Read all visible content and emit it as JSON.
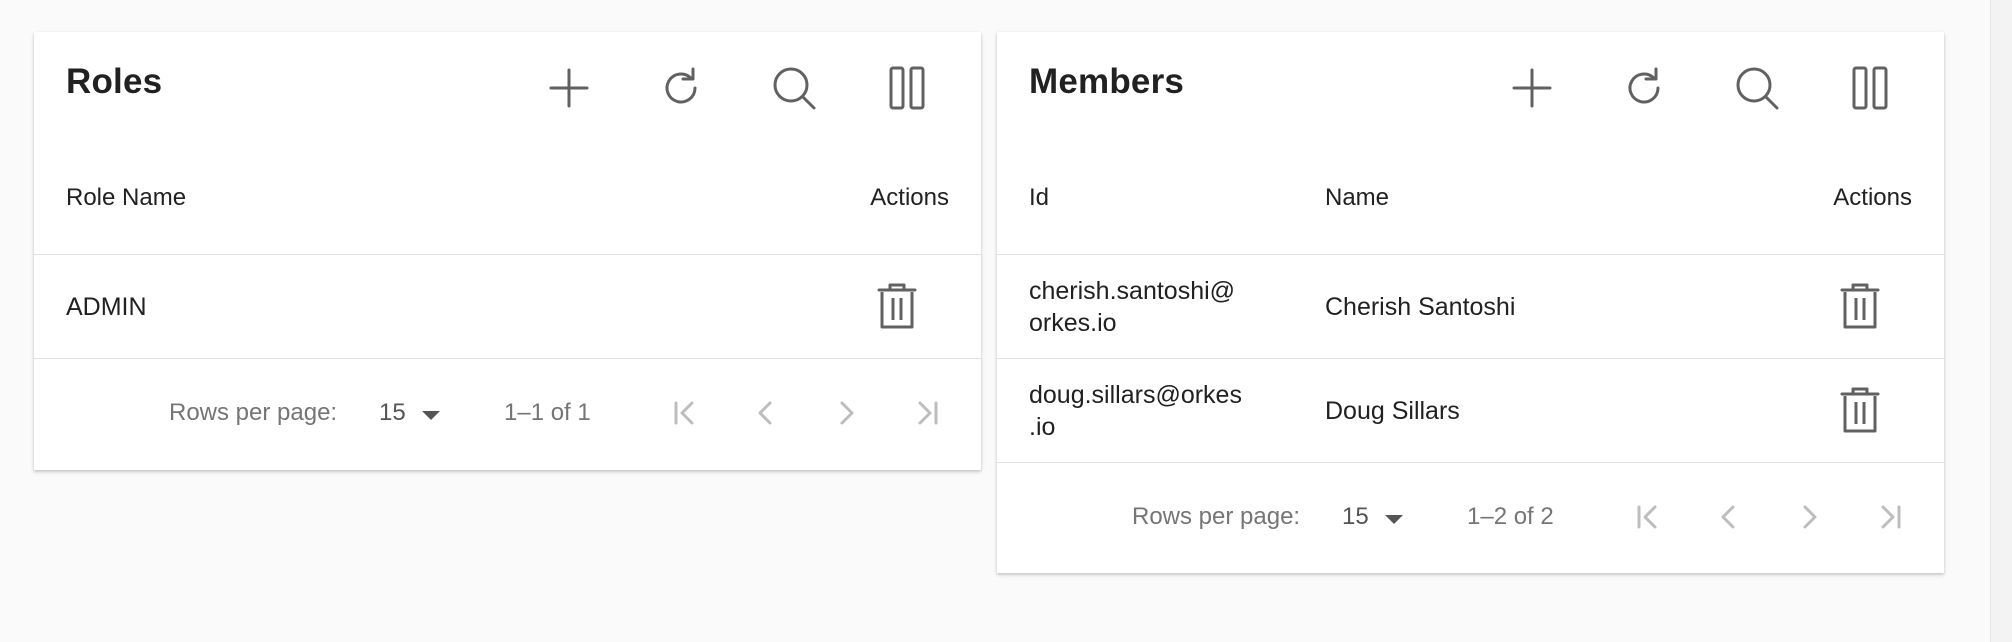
{
  "roles_panel": {
    "title": "Roles",
    "columns": {
      "role_name": "Role Name",
      "actions": "Actions"
    },
    "rows": [
      {
        "role_name": "ADMIN"
      }
    ],
    "pagination": {
      "rows_per_page_label": "Rows per page:",
      "rows_per_page_value": "15",
      "range_text": "1–1 of 1"
    }
  },
  "members_panel": {
    "title": "Members",
    "columns": {
      "id": "Id",
      "name": "Name",
      "actions": "Actions"
    },
    "rows": [
      {
        "id_line1": "cherish.santoshi@",
        "id_line2": "orkes.io",
        "name": "Cherish Santoshi"
      },
      {
        "id_line1": "doug.sillars@orkes",
        "id_line2": ".io",
        "name": "Doug Sillars"
      }
    ],
    "pagination": {
      "rows_per_page_label": "Rows per page:",
      "rows_per_page_value": "15",
      "range_text": "1–2 of 2"
    }
  },
  "icons": {
    "toolbar": [
      "plus-icon",
      "refresh-icon",
      "search-icon",
      "columns-icon"
    ],
    "row_action": "trash-icon",
    "pager": [
      "first-page-icon",
      "previous-page-icon",
      "next-page-icon",
      "last-page-icon"
    ]
  },
  "colors": {
    "icon": "#616161",
    "pager_icon_disabled": "#bdbdbd",
    "divider": "#e0e0e0"
  }
}
